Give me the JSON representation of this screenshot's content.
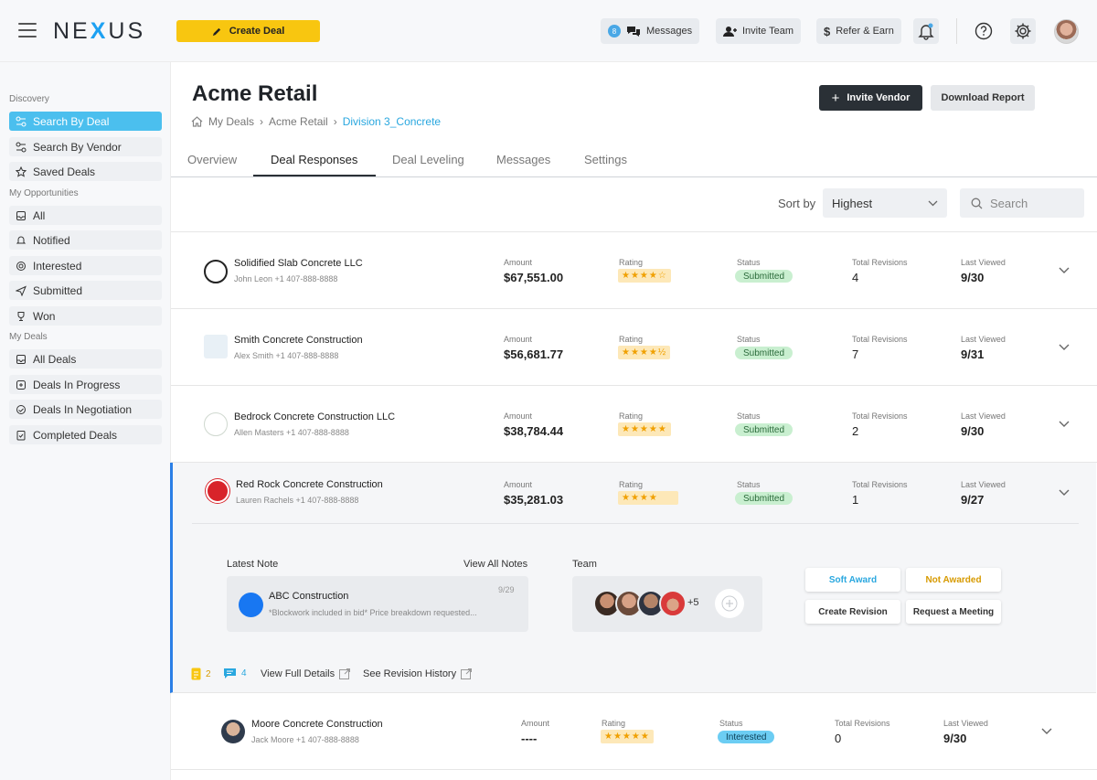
{
  "app": {
    "logo": "NEXUS"
  },
  "topbar": {
    "create_deal": "Create Deal",
    "messages_label": "Messages",
    "messages_count": "8",
    "invite_team": "Invite Team",
    "refer_earn": "Refer & Earn"
  },
  "sidebar": {
    "discovery": "Discovery",
    "search_by_deal": "Search By Deal",
    "search_by_vendor": "Search By Vendor",
    "saved_deals": "Saved Deals",
    "my_opportunities": "My Opportunities",
    "all": "All",
    "notified": "Notified",
    "interested": "Interested",
    "submitted": "Submitted",
    "won": "Won",
    "my_deals": "My Deals",
    "all_deals": "All Deals",
    "deals_in_progress": "Deals In Progress",
    "deals_in_negotiation": "Deals In Negotiation",
    "completed_deals": "Completed Deals"
  },
  "page": {
    "title": "Acme Retail",
    "breadcrumb": [
      "My Deals",
      "Acme Retail",
      "Division 3_Concrete"
    ],
    "invite_vendor": "Invite Vendor",
    "download_report": "Download Report"
  },
  "tabs": [
    "Overview",
    "Deal Responses",
    "Deal Leveling",
    "Messages",
    "Settings"
  ],
  "sort": {
    "label": "Sort by",
    "value": "Highest",
    "search_placeholder": "Search"
  },
  "labels": {
    "amount": "Amount",
    "rating": "Rating",
    "status": "Status",
    "revisions": "Total Revisions",
    "viewed": "Last Viewed"
  },
  "rows": [
    {
      "name": "Solidified Slab Concrete LLC",
      "contact": "John Leon +1 407-888-8888",
      "amount": "$67,551.00",
      "stars": "★★★★☆",
      "status": "Submitted",
      "revisions": "4",
      "viewed": "9/30"
    },
    {
      "name": "Smith Concrete Construction",
      "contact": "Alex Smith +1 407-888-8888",
      "amount": "$56,681.77",
      "stars": "★★★★½",
      "status": "Submitted",
      "revisions": "7",
      "viewed": "9/31"
    },
    {
      "name": "Bedrock Concrete Construction LLC",
      "contact": "Allen Masters +1 407-888-8888",
      "amount": "$38,784.44",
      "stars": "★★★★★",
      "status": "Submitted",
      "revisions": "2",
      "viewed": "9/30"
    },
    {
      "name": "Red Rock Concrete Construction",
      "contact": "Lauren Rachels +1 407-888-8888",
      "amount": "$35,281.03",
      "stars": "★★★★",
      "status": "Submitted",
      "revisions": "1",
      "viewed": "9/27"
    },
    {
      "name": "Moore Concrete Construction",
      "contact": "Jack Moore +1 407-888-8888",
      "amount": "----",
      "stars": "★★★★★",
      "status": "Interested",
      "revisions": "0",
      "viewed": "9/30"
    }
  ],
  "expanded": {
    "latest_note": "Latest Note",
    "view_all_notes": "View All Notes",
    "note_author": "ABC Construction",
    "note_date": "9/29",
    "note_text": "*Blockwork included in bid* Price breakdown requested...",
    "team": "Team",
    "team_more": "+5",
    "soft_award": "Soft Award",
    "not_awarded": "Not Awarded",
    "create_revision": "Create Revision",
    "request_meeting": "Request a Meeting",
    "doc_count": "2",
    "msg_count": "4",
    "view_full_details": "View Full Details",
    "see_revision_history": "See Revision History"
  },
  "colors": {
    "accent": "#4bbfee",
    "brand_yellow": "#f8c610",
    "expanded_border": "#2b7fe6"
  }
}
